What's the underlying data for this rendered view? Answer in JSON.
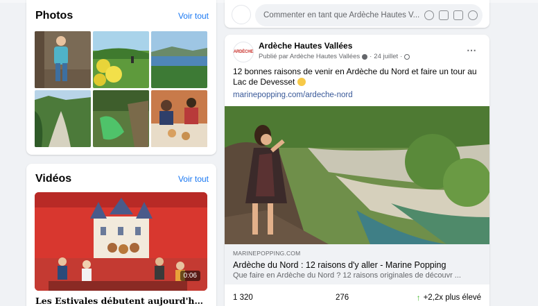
{
  "photos": {
    "title": "Photos",
    "see_all": "Voir tout",
    "items": [
      "photo-1",
      "photo-2",
      "photo-3",
      "photo-4",
      "photo-5",
      "photo-6"
    ]
  },
  "videos": {
    "title": "Vidéos",
    "see_all": "Voir tout",
    "items": [
      {
        "duration": "0:06",
        "title": "Les Estivales débutent aujourd'hui ! ..."
      }
    ]
  },
  "comment_box": {
    "placeholder": "Commenter en tant que Ardèche Hautes V..."
  },
  "post": {
    "author": "Ardèche Hautes Vallées",
    "avatar_text": "ARDÈCHE",
    "meta_published_by": "Publié par Ardèche Hautes Vallées",
    "meta_date": "24 juillet",
    "more_icon": "⋯",
    "text": "12 bonnes raisons de venir en Ardèche du Nord et faire un tour au Lac de Devesset",
    "link": "marinepopping.com/ardeche-nord",
    "preview": {
      "domain": "MARINEPOPPING.COM",
      "title": "Ardèche du Nord : 12 raisons d'y aller - Marine Popping",
      "description": "Que faire en Ardèche du Nord ? 12 raisons originales de découvr ..."
    },
    "stats": {
      "reach": "1 320",
      "engagements": "276",
      "arrow": "↑",
      "performance": "+2,2x plus élevé"
    }
  },
  "colors": {
    "accent": "#1877f2",
    "link": "#385898",
    "positive": "#42b72a",
    "background": "#f0f2f5"
  }
}
